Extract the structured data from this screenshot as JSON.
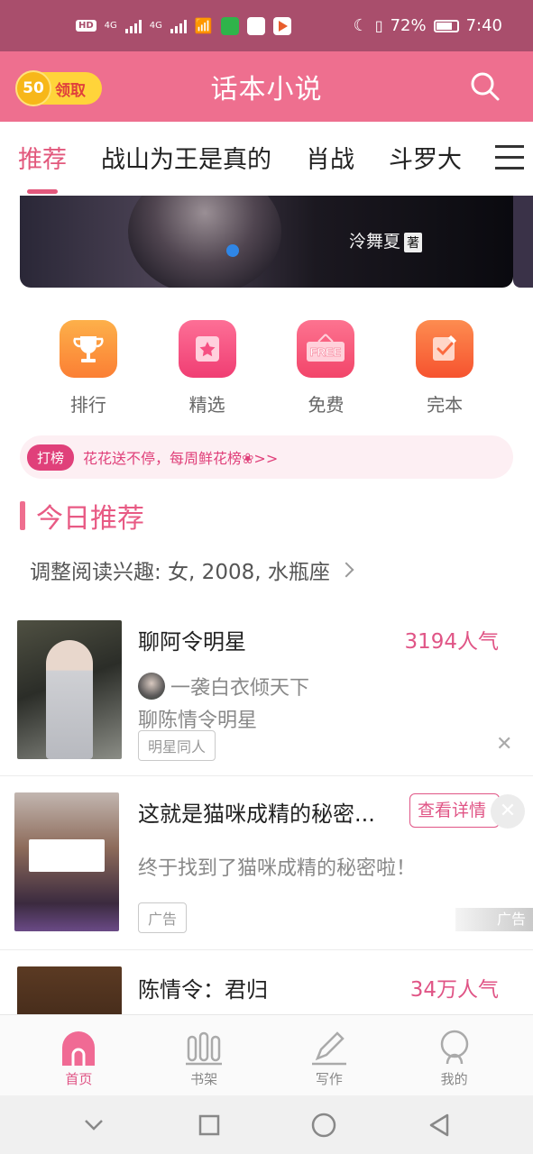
{
  "status_bar": {
    "hd_label": "HD",
    "network_1": "4G",
    "network_2": "4G",
    "battery": "72%",
    "time": "7:40"
  },
  "header": {
    "coins": "50",
    "reward_label": "领取",
    "title": "话本小说",
    "search_icon": "search-icon"
  },
  "tabs": [
    {
      "label": "推荐",
      "active": true
    },
    {
      "label": "战山为王是真的"
    },
    {
      "label": "肖战"
    },
    {
      "label": "斗罗大"
    }
  ],
  "banner": {
    "author": "泠舞夏",
    "seal": "著"
  },
  "categories": [
    {
      "label": "排行",
      "icon": "trophy-icon",
      "color": "#fb8f3c"
    },
    {
      "label": "精选",
      "icon": "star-icon",
      "color": "#f65083"
    },
    {
      "label": "免费",
      "icon": "free-sign-icon",
      "color": "#f65572",
      "badge": "FREE"
    },
    {
      "label": "完本",
      "icon": "checklist-icon",
      "color": "#fb6a3f"
    }
  ],
  "notice": {
    "tag": "打榜",
    "text": "花花送不停，每周鲜花榜❀>>"
  },
  "section": {
    "title": "今日推荐",
    "preferences": "调整阅读兴趣: 女, 2008, 水瓶座"
  },
  "books": [
    {
      "title": "聊阿令明星",
      "popularity": "3194人气",
      "author": "一袭白衣倾天下",
      "desc": "聊陈情令明星",
      "tag": "明星同人"
    },
    {
      "title": "这就是猫咪成精的秘密...",
      "desc": "终于找到了猫咪成精的秘密啦！",
      "tag": "广告",
      "cta": "查看详情",
      "ad_badge": "广告"
    },
    {
      "title": "陈情令：君归",
      "popularity": "34万人气"
    }
  ],
  "bottom_nav": [
    {
      "label": "首页",
      "icon": "home-icon",
      "active": true
    },
    {
      "label": "书架",
      "icon": "bookshelf-icon"
    },
    {
      "label": "写作",
      "icon": "pen-icon"
    },
    {
      "label": "我的",
      "icon": "profile-icon"
    }
  ],
  "colors": {
    "status_bar": "#a94e6c",
    "header": "#ee6f8f",
    "accent": "#e05586"
  }
}
